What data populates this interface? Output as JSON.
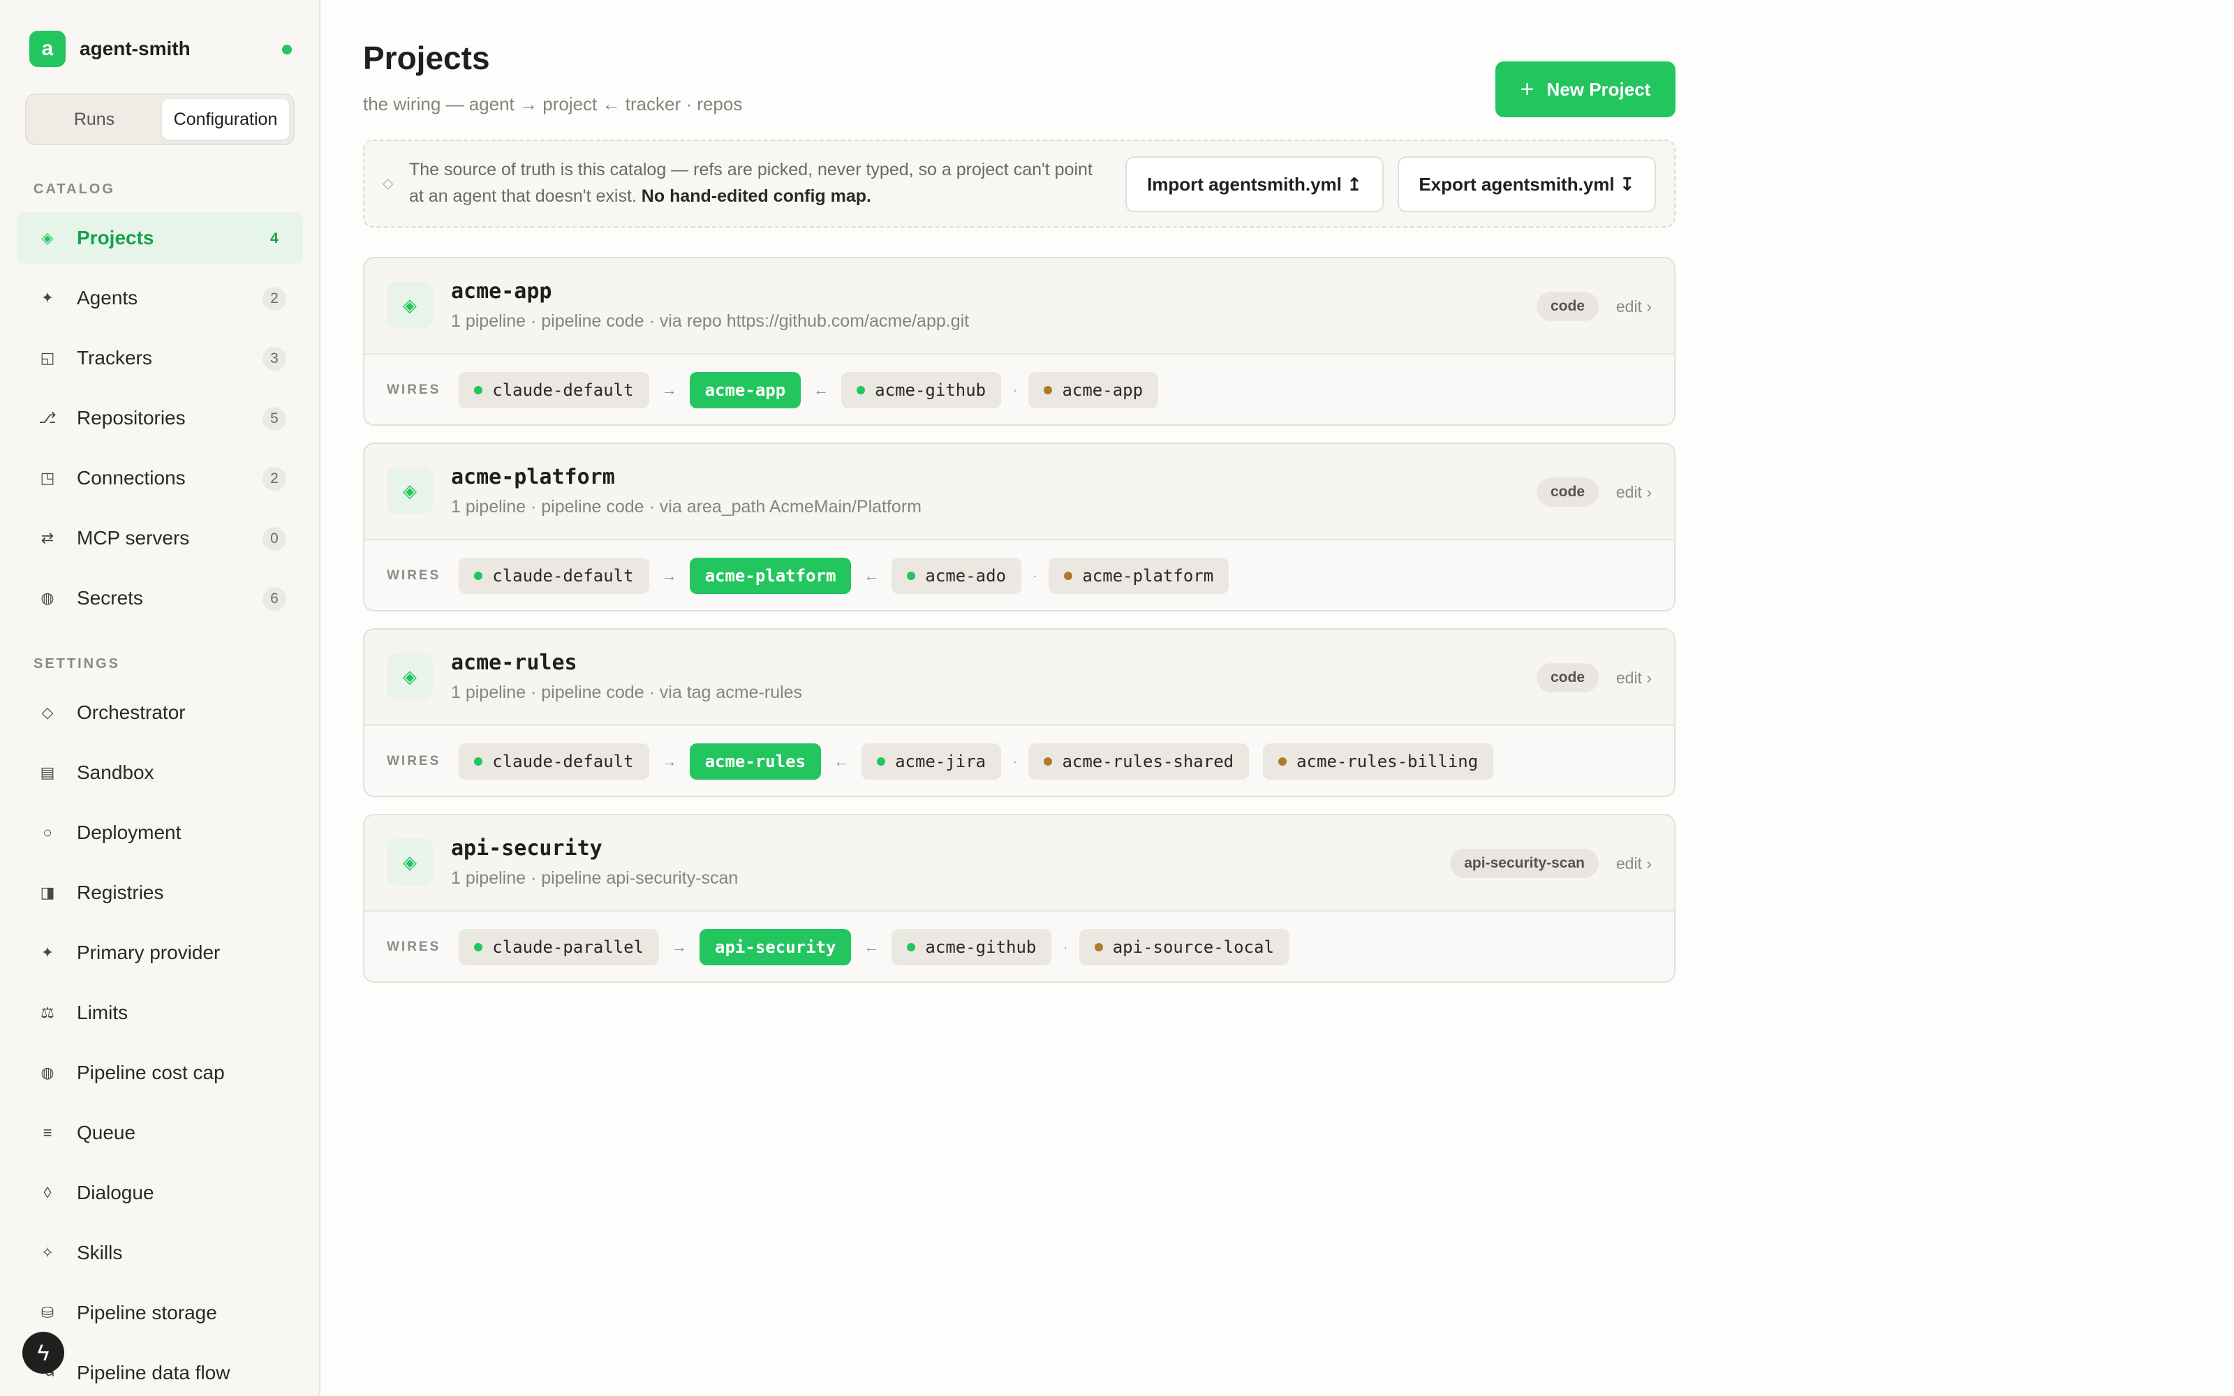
{
  "brand": {
    "initial": "a",
    "name": "agent-smith",
    "status_color": "#22c55e"
  },
  "tabs": [
    {
      "label": "Runs",
      "active": false
    },
    {
      "label": "Configuration",
      "active": true
    }
  ],
  "sidebar": {
    "catalog_label": "CATALOG",
    "catalog": [
      {
        "label": "Projects",
        "count": "4",
        "icon": "diamond-icon",
        "active": true
      },
      {
        "label": "Agents",
        "count": "2",
        "icon": "sparkle-icon"
      },
      {
        "label": "Trackers",
        "count": "3",
        "icon": "tracker-icon"
      },
      {
        "label": "Repositories",
        "count": "5",
        "icon": "branch-icon"
      },
      {
        "label": "Connections",
        "count": "2",
        "icon": "connection-icon"
      },
      {
        "label": "MCP servers",
        "count": "0",
        "icon": "arrows-icon"
      },
      {
        "label": "Secrets",
        "count": "6",
        "icon": "secret-icon"
      }
    ],
    "settings_label": "SETTINGS",
    "settings": [
      {
        "label": "Orchestrator",
        "icon": "orchestrator-icon"
      },
      {
        "label": "Sandbox",
        "icon": "sandbox-icon"
      },
      {
        "label": "Deployment",
        "icon": "deployment-icon"
      },
      {
        "label": "Registries",
        "icon": "registry-icon"
      },
      {
        "label": "Primary provider",
        "icon": "provider-icon"
      },
      {
        "label": "Limits",
        "icon": "scale-icon"
      },
      {
        "label": "Pipeline cost cap",
        "icon": "coin-icon"
      },
      {
        "label": "Queue",
        "icon": "queue-icon"
      },
      {
        "label": "Dialogue",
        "icon": "dialogue-icon"
      },
      {
        "label": "Skills",
        "icon": "skills-icon"
      },
      {
        "label": "Pipeline storage",
        "icon": "storage-icon"
      },
      {
        "label": "Pipeline data flow",
        "icon": "dataflow-icon"
      }
    ]
  },
  "header": {
    "title": "Projects",
    "subtitle": "the wiring — agent → project ← tracker · repos",
    "new_button": "New Project"
  },
  "info": {
    "text": "The source of truth is this catalog — refs are picked, never typed, so a project can't point at an agent that doesn't exist.",
    "bold": "No hand-edited config map.",
    "import_button": "Import agentsmith.yml ↥",
    "export_button": "Export agentsmith.yml ↧"
  },
  "wires_label": "WIRES",
  "edit_label": "edit ›",
  "colors": {
    "accent": "#22c55e",
    "tracker_dot": "#22c55e",
    "repo_dot": "#b07a2a"
  },
  "projects": [
    {
      "name": "acme-app",
      "meta": "1 pipeline · pipeline code · via repo https://github.com/acme/app.git",
      "badge": "code",
      "agent": "claude-default",
      "project": "acme-app",
      "tracker": "acme-github",
      "repos": [
        "acme-app"
      ]
    },
    {
      "name": "acme-platform",
      "meta": "1 pipeline · pipeline code · via area_path AcmeMain/Platform",
      "badge": "code",
      "agent": "claude-default",
      "project": "acme-platform",
      "tracker": "acme-ado",
      "repos": [
        "acme-platform"
      ]
    },
    {
      "name": "acme-rules",
      "meta": "1 pipeline · pipeline code · via tag acme-rules",
      "badge": "code",
      "agent": "claude-default",
      "project": "acme-rules",
      "tracker": "acme-jira",
      "repos": [
        "acme-rules-shared",
        "acme-rules-billing"
      ]
    },
    {
      "name": "api-security",
      "meta": "1 pipeline · pipeline api-security-scan",
      "badge": "api-security-scan",
      "agent": "claude-parallel",
      "project": "api-security",
      "tracker": "acme-github",
      "repos": [
        "api-source-local"
      ]
    }
  ]
}
